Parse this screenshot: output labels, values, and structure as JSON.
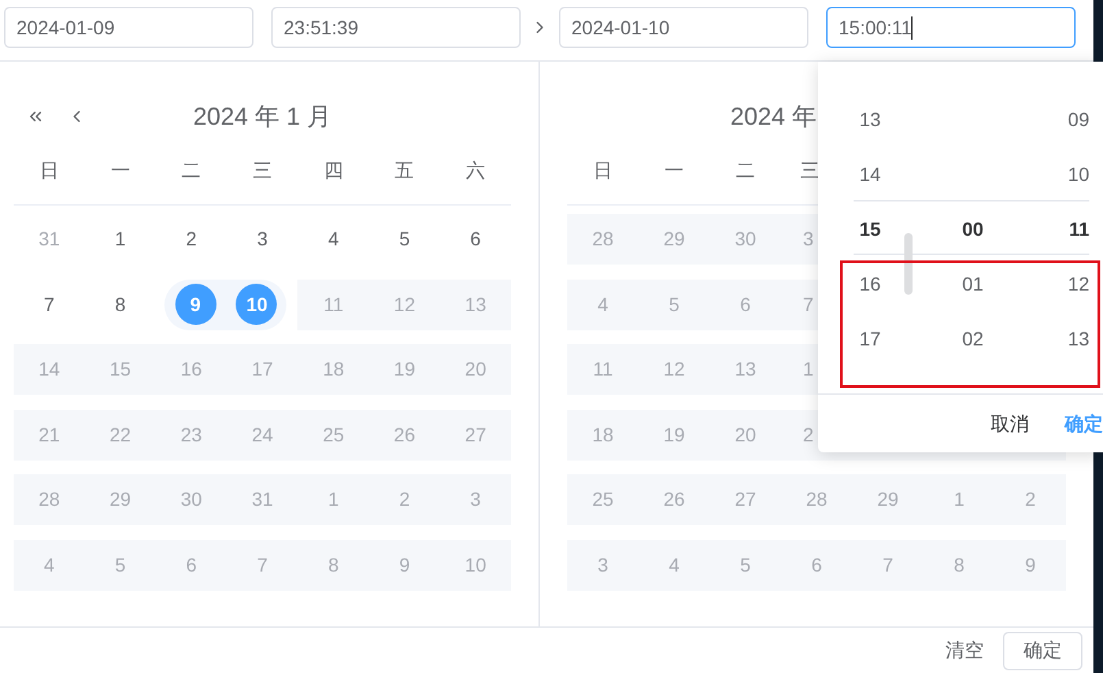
{
  "inputs": [
    {
      "value": "2024-01-09",
      "focused": false
    },
    {
      "value": "23:51:39",
      "focused": false
    },
    {
      "value": "2024-01-10",
      "focused": false
    },
    {
      "value": "15:00:11",
      "focused": true
    }
  ],
  "left_calendar": {
    "title": "2024 年 1 月",
    "weekdays": [
      "日",
      "一",
      "二",
      "三",
      "四",
      "五",
      "六"
    ],
    "rows": [
      [
        {
          "d": "31",
          "kind": "other",
          "selected": false
        },
        {
          "d": "1",
          "kind": "normal",
          "selected": false
        },
        {
          "d": "2",
          "kind": "normal",
          "selected": false
        },
        {
          "d": "3",
          "kind": "normal",
          "selected": false
        },
        {
          "d": "4",
          "kind": "normal",
          "selected": false
        },
        {
          "d": "5",
          "kind": "normal",
          "selected": false
        },
        {
          "d": "6",
          "kind": "normal",
          "selected": false
        }
      ],
      [
        {
          "d": "7",
          "kind": "normal",
          "selected": false
        },
        {
          "d": "8",
          "kind": "normal",
          "selected": false
        },
        {
          "d": "9",
          "kind": "normal",
          "selected": true
        },
        {
          "d": "10",
          "kind": "normal",
          "selected": true
        },
        {
          "d": "11",
          "kind": "disabled",
          "selected": false
        },
        {
          "d": "12",
          "kind": "disabled",
          "selected": false
        },
        {
          "d": "13",
          "kind": "disabled",
          "selected": false
        }
      ],
      [
        {
          "d": "14",
          "kind": "disabled",
          "selected": false
        },
        {
          "d": "15",
          "kind": "disabled",
          "selected": false
        },
        {
          "d": "16",
          "kind": "disabled",
          "selected": false
        },
        {
          "d": "17",
          "kind": "disabled",
          "selected": false
        },
        {
          "d": "18",
          "kind": "disabled",
          "selected": false
        },
        {
          "d": "19",
          "kind": "disabled",
          "selected": false
        },
        {
          "d": "20",
          "kind": "disabled",
          "selected": false
        }
      ],
      [
        {
          "d": "21",
          "kind": "disabled",
          "selected": false
        },
        {
          "d": "22",
          "kind": "disabled",
          "selected": false
        },
        {
          "d": "23",
          "kind": "disabled",
          "selected": false
        },
        {
          "d": "24",
          "kind": "disabled",
          "selected": false
        },
        {
          "d": "25",
          "kind": "disabled",
          "selected": false
        },
        {
          "d": "26",
          "kind": "disabled",
          "selected": false
        },
        {
          "d": "27",
          "kind": "disabled",
          "selected": false
        }
      ],
      [
        {
          "d": "28",
          "kind": "disabled",
          "selected": false
        },
        {
          "d": "29",
          "kind": "disabled",
          "selected": false
        },
        {
          "d": "30",
          "kind": "disabled",
          "selected": false
        },
        {
          "d": "31",
          "kind": "disabled",
          "selected": false
        },
        {
          "d": "1",
          "kind": "disabled",
          "selected": false
        },
        {
          "d": "2",
          "kind": "disabled",
          "selected": false
        },
        {
          "d": "3",
          "kind": "disabled",
          "selected": false
        }
      ],
      [
        {
          "d": "4",
          "kind": "disabled",
          "selected": false
        },
        {
          "d": "5",
          "kind": "disabled",
          "selected": false
        },
        {
          "d": "6",
          "kind": "disabled",
          "selected": false
        },
        {
          "d": "7",
          "kind": "disabled",
          "selected": false
        },
        {
          "d": "8",
          "kind": "disabled",
          "selected": false
        },
        {
          "d": "9",
          "kind": "disabled",
          "selected": false
        },
        {
          "d": "10",
          "kind": "disabled",
          "selected": false
        }
      ]
    ]
  },
  "right_calendar": {
    "title": "2024 年",
    "weekdays": [
      "日",
      "一",
      "二",
      "三"
    ],
    "rows": [
      [
        "28",
        "29",
        "30",
        "3"
      ],
      [
        "4",
        "5",
        "6",
        "7"
      ],
      [
        "11",
        "12",
        "13",
        "1"
      ],
      [
        "18",
        "19",
        "20",
        "2"
      ],
      [
        "25",
        "26",
        "27",
        "28",
        "29",
        "1",
        "2"
      ],
      [
        "3",
        "4",
        "5",
        "6",
        "7",
        "8",
        "9"
      ]
    ]
  },
  "time_panel": {
    "columns": [
      [
        {
          "text": "13",
          "selected": false
        },
        {
          "text": "14",
          "selected": false
        },
        {
          "text": "15",
          "selected": true
        },
        {
          "text": "16",
          "selected": false
        },
        {
          "text": "17",
          "selected": false
        }
      ],
      [
        {
          "text": "00",
          "selected": true
        },
        {
          "text": "01",
          "selected": false
        },
        {
          "text": "02",
          "selected": false
        }
      ],
      [
        {
          "text": "09",
          "selected": false
        },
        {
          "text": "10",
          "selected": false
        },
        {
          "text": "11",
          "selected": true
        },
        {
          "text": "12",
          "selected": false
        },
        {
          "text": "13",
          "selected": false
        }
      ]
    ],
    "cancel": "取消",
    "confirm": "确定"
  },
  "footer": {
    "clear": "清空",
    "confirm": "确定"
  }
}
